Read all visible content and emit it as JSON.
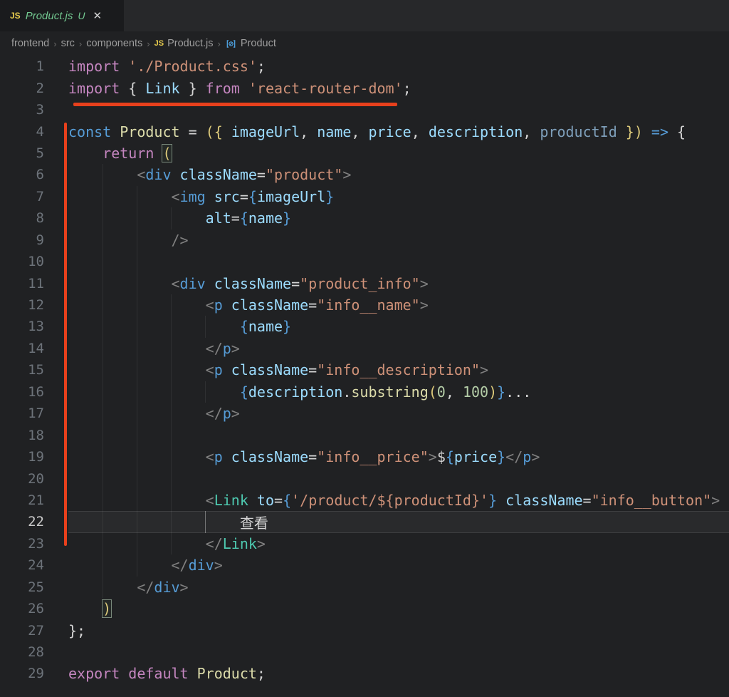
{
  "tab": {
    "file_icon": "JS",
    "label": "Product.js",
    "git_status": "U",
    "close": "✕"
  },
  "breadcrumb": {
    "separator": "›",
    "items": [
      {
        "label": "frontend",
        "icon": null
      },
      {
        "label": "src",
        "icon": null
      },
      {
        "label": "components",
        "icon": null
      },
      {
        "label": "Product.js",
        "icon": "js"
      },
      {
        "label": "Product",
        "icon": "symbol"
      }
    ]
  },
  "colors": {
    "annotation": "#e8401c",
    "syntax": {
      "k": "#C586C0",
      "b": "#569CD6",
      "f": "#DCDCAA",
      "s": "#CE9178",
      "p": "#D4D4D4",
      "g": "#808080",
      "a": "#9CDCFE",
      "d": "#7e9fba",
      "n": "#B5CEA8",
      "j": "#569CD6",
      "o": "#dcc97a",
      "t": "#4EC9B0"
    }
  },
  "editor": {
    "lines": [
      {
        "num": "1",
        "guides": [],
        "segments": [
          {
            "t": "import ",
            "c": "k"
          },
          {
            "t": "'./Product.css'",
            "c": "s"
          },
          {
            "t": ";",
            "c": "p"
          }
        ]
      },
      {
        "num": "2",
        "guides": [],
        "segments": [
          {
            "t": "import",
            "c": "k"
          },
          {
            "t": " { ",
            "c": "p"
          },
          {
            "t": "Link",
            "c": "a"
          },
          {
            "t": " } ",
            "c": "p"
          },
          {
            "t": "from",
            "c": "k"
          },
          {
            "t": " ",
            "c": "p"
          },
          {
            "t": "'react-router-dom'",
            "c": "s"
          },
          {
            "t": ";",
            "c": "p"
          }
        ]
      },
      {
        "num": "3",
        "guides": [],
        "segments": []
      },
      {
        "num": "4",
        "guides": [],
        "segments": [
          {
            "t": "const ",
            "c": "b"
          },
          {
            "t": "Product",
            "c": "f"
          },
          {
            "t": " = ",
            "c": "p"
          },
          {
            "t": "({",
            "c": "o"
          },
          {
            "t": " ",
            "c": "p"
          },
          {
            "t": "imageUrl",
            "c": "a"
          },
          {
            "t": ", ",
            "c": "p"
          },
          {
            "t": "name",
            "c": "a"
          },
          {
            "t": ", ",
            "c": "p"
          },
          {
            "t": "price",
            "c": "a"
          },
          {
            "t": ", ",
            "c": "p"
          },
          {
            "t": "description",
            "c": "a"
          },
          {
            "t": ", ",
            "c": "p"
          },
          {
            "t": "productId",
            "c": "d"
          },
          {
            "t": " ",
            "c": "p"
          },
          {
            "t": "})",
            "c": "o"
          },
          {
            "t": " ",
            "c": "p"
          },
          {
            "t": "=>",
            "c": "b"
          },
          {
            "t": " {",
            "c": "p"
          }
        ]
      },
      {
        "num": "5",
        "guides": [],
        "segments": [
          {
            "t": "    ",
            "c": "p"
          },
          {
            "t": "return",
            "c": "k"
          },
          {
            "t": " ",
            "c": "p"
          },
          {
            "t": "(",
            "c": "o",
            "box": true
          }
        ]
      },
      {
        "num": "6",
        "guides": [
          1
        ],
        "segments": [
          {
            "t": "        ",
            "c": "p"
          },
          {
            "t": "<",
            "c": "g"
          },
          {
            "t": "div",
            "c": "b"
          },
          {
            "t": " ",
            "c": "p"
          },
          {
            "t": "className",
            "c": "a"
          },
          {
            "t": "=",
            "c": "p"
          },
          {
            "t": "\"product\"",
            "c": "s"
          },
          {
            "t": ">",
            "c": "g"
          }
        ]
      },
      {
        "num": "7",
        "guides": [
          1,
          2
        ],
        "segments": [
          {
            "t": "            ",
            "c": "p"
          },
          {
            "t": "<",
            "c": "g"
          },
          {
            "t": "img",
            "c": "b"
          },
          {
            "t": " ",
            "c": "p"
          },
          {
            "t": "src",
            "c": "a"
          },
          {
            "t": "=",
            "c": "p"
          },
          {
            "t": "{",
            "c": "j"
          },
          {
            "t": "imageUrl",
            "c": "a"
          },
          {
            "t": "}",
            "c": "j"
          }
        ]
      },
      {
        "num": "8",
        "guides": [
          1,
          2,
          3
        ],
        "segments": [
          {
            "t": "                ",
            "c": "p"
          },
          {
            "t": "alt",
            "c": "a"
          },
          {
            "t": "=",
            "c": "p"
          },
          {
            "t": "{",
            "c": "j"
          },
          {
            "t": "name",
            "c": "a"
          },
          {
            "t": "}",
            "c": "j"
          }
        ]
      },
      {
        "num": "9",
        "guides": [
          1,
          2
        ],
        "segments": [
          {
            "t": "            ",
            "c": "p"
          },
          {
            "t": "/>",
            "c": "g"
          }
        ]
      },
      {
        "num": "10",
        "guides": [
          1,
          2
        ],
        "segments": []
      },
      {
        "num": "11",
        "guides": [
          1,
          2
        ],
        "segments": [
          {
            "t": "            ",
            "c": "p"
          },
          {
            "t": "<",
            "c": "g"
          },
          {
            "t": "div",
            "c": "b"
          },
          {
            "t": " ",
            "c": "p"
          },
          {
            "t": "className",
            "c": "a"
          },
          {
            "t": "=",
            "c": "p"
          },
          {
            "t": "\"product_info\"",
            "c": "s"
          },
          {
            "t": ">",
            "c": "g"
          }
        ]
      },
      {
        "num": "12",
        "guides": [
          1,
          2,
          3
        ],
        "segments": [
          {
            "t": "                ",
            "c": "p"
          },
          {
            "t": "<",
            "c": "g"
          },
          {
            "t": "p",
            "c": "b"
          },
          {
            "t": " ",
            "c": "p"
          },
          {
            "t": "className",
            "c": "a"
          },
          {
            "t": "=",
            "c": "p"
          },
          {
            "t": "\"info__name\"",
            "c": "s"
          },
          {
            "t": ">",
            "c": "g"
          }
        ]
      },
      {
        "num": "13",
        "guides": [
          1,
          2,
          3,
          4
        ],
        "segments": [
          {
            "t": "                    ",
            "c": "p"
          },
          {
            "t": "{",
            "c": "j"
          },
          {
            "t": "name",
            "c": "a"
          },
          {
            "t": "}",
            "c": "j"
          }
        ]
      },
      {
        "num": "14",
        "guides": [
          1,
          2,
          3
        ],
        "segments": [
          {
            "t": "                ",
            "c": "p"
          },
          {
            "t": "</",
            "c": "g"
          },
          {
            "t": "p",
            "c": "b"
          },
          {
            "t": ">",
            "c": "g"
          }
        ]
      },
      {
        "num": "15",
        "guides": [
          1,
          2,
          3
        ],
        "segments": [
          {
            "t": "                ",
            "c": "p"
          },
          {
            "t": "<",
            "c": "g"
          },
          {
            "t": "p",
            "c": "b"
          },
          {
            "t": " ",
            "c": "p"
          },
          {
            "t": "className",
            "c": "a"
          },
          {
            "t": "=",
            "c": "p"
          },
          {
            "t": "\"info__description\"",
            "c": "s"
          },
          {
            "t": ">",
            "c": "g"
          }
        ]
      },
      {
        "num": "16",
        "guides": [
          1,
          2,
          3,
          4
        ],
        "segments": [
          {
            "t": "                    ",
            "c": "p"
          },
          {
            "t": "{",
            "c": "j"
          },
          {
            "t": "description",
            "c": "a"
          },
          {
            "t": ".",
            "c": "p"
          },
          {
            "t": "substring",
            "c": "f"
          },
          {
            "t": "(",
            "c": "o"
          },
          {
            "t": "0",
            "c": "n"
          },
          {
            "t": ", ",
            "c": "p"
          },
          {
            "t": "100",
            "c": "n"
          },
          {
            "t": ")",
            "c": "o"
          },
          {
            "t": "}",
            "c": "j"
          },
          {
            "t": "...",
            "c": "p"
          }
        ]
      },
      {
        "num": "17",
        "guides": [
          1,
          2,
          3
        ],
        "segments": [
          {
            "t": "                ",
            "c": "p"
          },
          {
            "t": "</",
            "c": "g"
          },
          {
            "t": "p",
            "c": "b"
          },
          {
            "t": ">",
            "c": "g"
          }
        ]
      },
      {
        "num": "18",
        "guides": [
          1,
          2,
          3
        ],
        "segments": []
      },
      {
        "num": "19",
        "guides": [
          1,
          2,
          3
        ],
        "segments": [
          {
            "t": "                ",
            "c": "p"
          },
          {
            "t": "<",
            "c": "g"
          },
          {
            "t": "p",
            "c": "b"
          },
          {
            "t": " ",
            "c": "p"
          },
          {
            "t": "className",
            "c": "a"
          },
          {
            "t": "=",
            "c": "p"
          },
          {
            "t": "\"info__price\"",
            "c": "s"
          },
          {
            "t": ">",
            "c": "g"
          },
          {
            "t": "$",
            "c": "p"
          },
          {
            "t": "{",
            "c": "j"
          },
          {
            "t": "price",
            "c": "a"
          },
          {
            "t": "}",
            "c": "j"
          },
          {
            "t": "</",
            "c": "g"
          },
          {
            "t": "p",
            "c": "b"
          },
          {
            "t": ">",
            "c": "g"
          }
        ]
      },
      {
        "num": "20",
        "guides": [
          1,
          2,
          3
        ],
        "segments": []
      },
      {
        "num": "21",
        "guides": [
          1,
          2,
          3
        ],
        "segments": [
          {
            "t": "                ",
            "c": "p"
          },
          {
            "t": "<",
            "c": "g"
          },
          {
            "t": "Link",
            "c": "t"
          },
          {
            "t": " ",
            "c": "p"
          },
          {
            "t": "to",
            "c": "a"
          },
          {
            "t": "=",
            "c": "p"
          },
          {
            "t": "{",
            "c": "j"
          },
          {
            "t": "'/product/${productId}'",
            "c": "s"
          },
          {
            "t": "}",
            "c": "j"
          },
          {
            "t": " ",
            "c": "p"
          },
          {
            "t": "className",
            "c": "a"
          },
          {
            "t": "=",
            "c": "p"
          },
          {
            "t": "\"info__button\"",
            "c": "s"
          },
          {
            "t": ">",
            "c": "g"
          }
        ]
      },
      {
        "num": "22",
        "guides": [
          1,
          2,
          3
        ],
        "activeGuide": 4,
        "active": true,
        "segments": [
          {
            "t": "                    查看",
            "c": "p"
          }
        ]
      },
      {
        "num": "23",
        "guides": [
          1,
          2,
          3
        ],
        "segments": [
          {
            "t": "                ",
            "c": "p"
          },
          {
            "t": "</",
            "c": "g"
          },
          {
            "t": "Link",
            "c": "t"
          },
          {
            "t": ">",
            "c": "g"
          }
        ]
      },
      {
        "num": "24",
        "guides": [
          1,
          2
        ],
        "segments": [
          {
            "t": "            ",
            "c": "p"
          },
          {
            "t": "</",
            "c": "g"
          },
          {
            "t": "div",
            "c": "b"
          },
          {
            "t": ">",
            "c": "g"
          }
        ]
      },
      {
        "num": "25",
        "guides": [
          1
        ],
        "segments": [
          {
            "t": "        ",
            "c": "p"
          },
          {
            "t": "</",
            "c": "g"
          },
          {
            "t": "div",
            "c": "b"
          },
          {
            "t": ">",
            "c": "g"
          }
        ]
      },
      {
        "num": "26",
        "guides": [],
        "segments": [
          {
            "t": "    ",
            "c": "p"
          },
          {
            "t": ")",
            "c": "o",
            "box": true
          }
        ]
      },
      {
        "num": "27",
        "guides": [],
        "segments": [
          {
            "t": "};",
            "c": "p"
          }
        ]
      },
      {
        "num": "28",
        "guides": [],
        "segments": []
      },
      {
        "num": "29",
        "guides": [],
        "segments": [
          {
            "t": "export default ",
            "c": "k"
          },
          {
            "t": "Product",
            "c": "f"
          },
          {
            "t": ";",
            "c": "p"
          }
        ]
      }
    ]
  }
}
